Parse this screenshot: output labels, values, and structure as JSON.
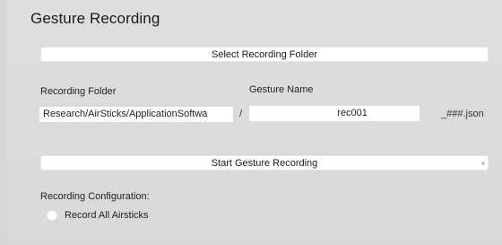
{
  "panel": {
    "title": "Gesture Recording"
  },
  "buttons": {
    "select_folder": "Select Recording Folder",
    "start_recording": "Start Gesture Recording"
  },
  "fields": {
    "folder_label": "Recording Folder",
    "folder_value": "Research/AirSticks/ApplicationSoftwa",
    "separator": "/",
    "gesture_label": "Gesture Name",
    "gesture_value": "rec001",
    "suffix": "_###.json"
  },
  "config": {
    "label": "Recording Configuration:",
    "options": [
      {
        "label": "Record All Airsticks",
        "selected": false
      }
    ]
  },
  "icons": {
    "dropdown": "chevron-down-icon",
    "radio": "radio-button-icon"
  }
}
